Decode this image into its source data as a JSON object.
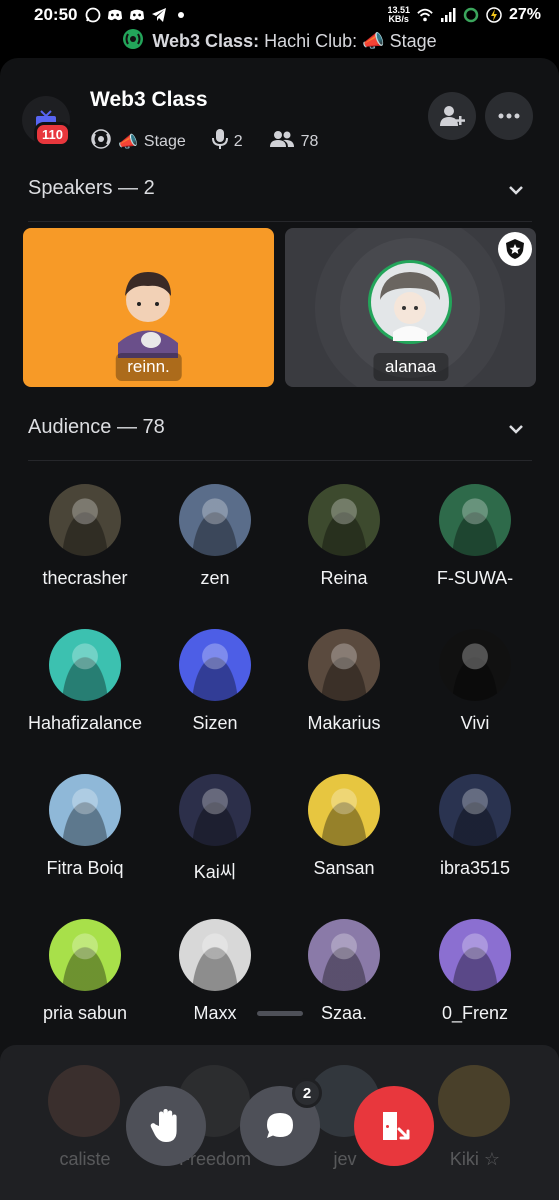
{
  "status_bar": {
    "time": "20:50",
    "net_speed_value": "13.51",
    "net_speed_unit": "KB/s",
    "battery": "27%"
  },
  "call_banner": {
    "server": "Web3 Class:",
    "channel": "Hachi Club:",
    "stage_emoji": "📣",
    "stage_label": "Stage"
  },
  "header": {
    "title": "Web3 Class",
    "notification_count": "110",
    "stage_emoji": "📣",
    "stage_label": "Stage",
    "speaker_count": "2",
    "member_count": "78"
  },
  "speakers_section": {
    "label": "Speakers — 2",
    "speakers": [
      {
        "name": "reinn.",
        "bg_color": "#f79a27"
      },
      {
        "name": "alanaa",
        "bg_color": "#3a3b40",
        "moderator": true
      }
    ]
  },
  "audience_section": {
    "label": "Audience — 78",
    "members": [
      {
        "name": "thecrasher",
        "color": "#4a4538"
      },
      {
        "name": "zen",
        "color": "#5a6d8a"
      },
      {
        "name": "Reina",
        "color": "#3d4a2e"
      },
      {
        "name": "F-SUWA-",
        "color": "#2e6a4a"
      },
      {
        "name": "Hahafizalance",
        "color": "#3cc1b0"
      },
      {
        "name": "Sizen",
        "color": "#4d5ee6"
      },
      {
        "name": "Makarius",
        "color": "#5a4a3e"
      },
      {
        "name": "Vivi",
        "color": "#111111"
      },
      {
        "name": "Fitra Boiq",
        "color": "#8fb8d8"
      },
      {
        "name": "Kai씨",
        "color": "#2c2f4a"
      },
      {
        "name": "Sansan",
        "color": "#e7c640"
      },
      {
        "name": "ibra3515",
        "color": "#2a3350"
      },
      {
        "name": "pria sabun",
        "color": "#a8e04a"
      },
      {
        "name": "Maxx",
        "color": "#d8d8d8"
      },
      {
        "name": "Szaa.",
        "color": "#8a7aa8"
      },
      {
        "name": "0_Frenz",
        "color": "#8b6fd1"
      }
    ],
    "partially_hidden": [
      "caliste",
      "Freedom",
      "jev",
      "Kiki ☆"
    ]
  },
  "controls": {
    "chat_unread": "2"
  },
  "icons": {
    "hand": "raise-hand-icon",
    "chat": "chat-icon",
    "leave": "leave-icon",
    "invite": "add-member-icon",
    "more": "more-icon"
  }
}
